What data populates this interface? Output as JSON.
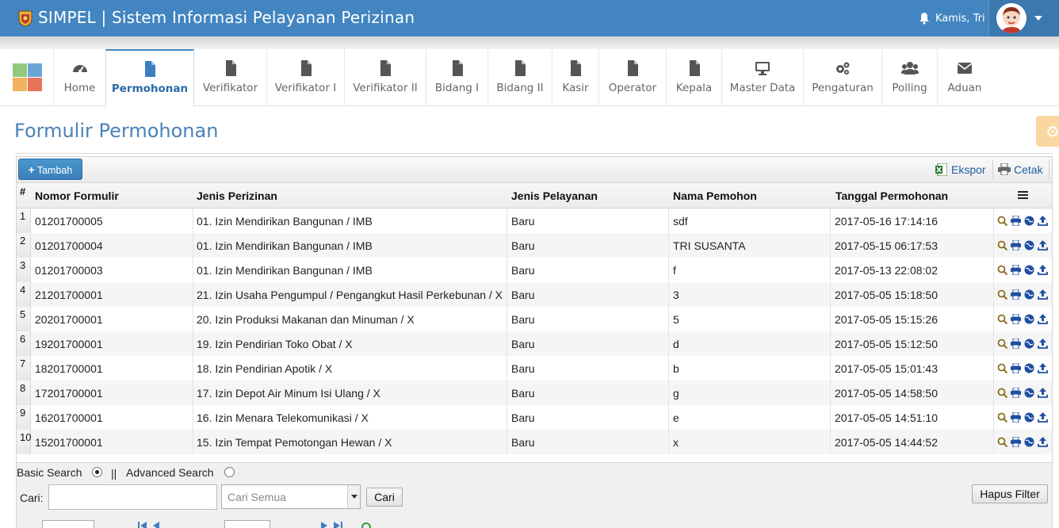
{
  "header": {
    "title": "SIMPEL | Sistem Informasi Pelayanan Perizinan",
    "user_name": "Kamis, Tri",
    "bg_color": "#4285c0"
  },
  "nav": {
    "items": [
      {
        "label": "Home",
        "icon": "dashboard-icon"
      },
      {
        "label": "Permohonan",
        "icon": "file-icon",
        "active": true
      },
      {
        "label": "Verifikator",
        "icon": "file-icon"
      },
      {
        "label": "Verifikator I",
        "icon": "file-icon"
      },
      {
        "label": "Verifikator II",
        "icon": "file-icon"
      },
      {
        "label": "Bidang I",
        "icon": "file-icon"
      },
      {
        "label": "Bidang II",
        "icon": "file-icon"
      },
      {
        "label": "Kasir",
        "icon": "file-icon"
      },
      {
        "label": "Operator",
        "icon": "file-icon"
      },
      {
        "label": "Kepala",
        "icon": "file-icon"
      },
      {
        "label": "Master Data",
        "icon": "monitor-icon"
      },
      {
        "label": "Pengaturan",
        "icon": "gears-icon"
      },
      {
        "label": "Polling",
        "icon": "users-icon"
      },
      {
        "label": "Aduan",
        "icon": "envelope-icon"
      }
    ]
  },
  "page": {
    "title": "Formulir Permohonan"
  },
  "toolbar": {
    "add_label": "Tambah",
    "export_label": "Ekspor",
    "print_label": "Cetak"
  },
  "table": {
    "columns": [
      "#",
      "Nomor Formulir",
      "Jenis Perizinan",
      "Jenis Pelayanan",
      "Nama Pemohon",
      "Tanggal Permohonan"
    ],
    "rows": [
      {
        "no": "1",
        "nomor": "01201700005",
        "jenis": "01. Izin Mendirikan Bangunan / IMB",
        "pelayanan": "Baru",
        "nama": "sdf",
        "tanggal": "2017-05-16 17:14:16"
      },
      {
        "no": "2",
        "nomor": "01201700004",
        "jenis": "01. Izin Mendirikan Bangunan / IMB",
        "pelayanan": "Baru",
        "nama": "TRI SUSANTA",
        "tanggal": "2017-05-15 06:17:53"
      },
      {
        "no": "3",
        "nomor": "01201700003",
        "jenis": "01. Izin Mendirikan Bangunan / IMB",
        "pelayanan": "Baru",
        "nama": "f",
        "tanggal": "2017-05-13 22:08:02"
      },
      {
        "no": "4",
        "nomor": "21201700001",
        "jenis": "21. Izin Usaha Pengumpul / Pengangkut Hasil Perkebunan / X",
        "pelayanan": "Baru",
        "nama": "3",
        "tanggal": "2017-05-05 15:18:50"
      },
      {
        "no": "5",
        "nomor": "20201700001",
        "jenis": "20. Izin Produksi Makanan dan Minuman / X",
        "pelayanan": "Baru",
        "nama": "5",
        "tanggal": "2017-05-05 15:15:26"
      },
      {
        "no": "6",
        "nomor": "19201700001",
        "jenis": "19. Izin Pendirian Toko Obat / X",
        "pelayanan": "Baru",
        "nama": "d",
        "tanggal": "2017-05-05 15:12:50"
      },
      {
        "no": "7",
        "nomor": "18201700001",
        "jenis": "18. Izin Pendirian Apotik / X",
        "pelayanan": "Baru",
        "nama": "b",
        "tanggal": "2017-05-05 15:01:43"
      },
      {
        "no": "8",
        "nomor": "17201700001",
        "jenis": "17. Izin Depot Air Minum Isi Ulang / X",
        "pelayanan": "Baru",
        "nama": "g",
        "tanggal": "2017-05-05 14:58:50"
      },
      {
        "no": "9",
        "nomor": "16201700001",
        "jenis": "16. Izin Menara Telekomunikasi / X",
        "pelayanan": "Baru",
        "nama": "e",
        "tanggal": "2017-05-05 14:51:10"
      },
      {
        "no": "10",
        "nomor": "15201700001",
        "jenis": "15. Izin Tempat Pemotongan Hewan / X",
        "pelayanan": "Baru",
        "nama": "x",
        "tanggal": "2017-05-05 14:44:52"
      }
    ],
    "row_actions": [
      "search-icon",
      "print-icon",
      "globe-icon",
      "upload-icon"
    ]
  },
  "search": {
    "basic_label": "Basic Search",
    "separator": "||",
    "advanced_label": "Advanced Search",
    "basic_selected": true,
    "cari_label": "Cari:",
    "cari_value": "",
    "select_value": "Cari Semua",
    "cari_button": "Cari",
    "clear_button": "Hapus Filter"
  }
}
